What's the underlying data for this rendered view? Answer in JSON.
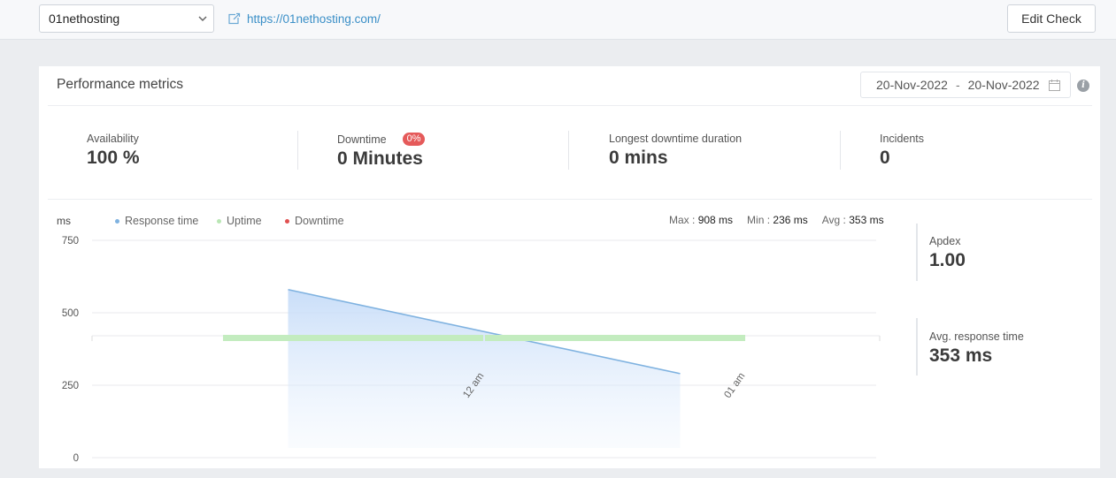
{
  "topbar": {
    "monitor_name": "01nethosting",
    "url": "https://01nethosting.com/",
    "edit_label": "Edit Check"
  },
  "card": {
    "title": "Performance metrics",
    "date_from": "20-Nov-2022",
    "date_sep": "-",
    "date_to": "20-Nov-2022"
  },
  "stats": {
    "availability": {
      "label": "Availability",
      "value": "100 %"
    },
    "downtime": {
      "label": "Downtime",
      "badge": "0%",
      "value": "0 Minutes"
    },
    "longest": {
      "label": "Longest downtime duration",
      "value": "0 mins"
    },
    "incidents": {
      "label": "Incidents",
      "value": "0"
    }
  },
  "side": {
    "apdex": {
      "label": "Apdex",
      "value": "1.00"
    },
    "avg_response": {
      "label": "Avg. response time",
      "value": "353 ms"
    }
  },
  "chart_data": {
    "type": "area",
    "ylabel": "ms",
    "ylim": [
      0,
      750
    ],
    "yticks": [
      0,
      250,
      500,
      750
    ],
    "xticks": [
      "12 am",
      "01 am"
    ],
    "legend": [
      {
        "name": "Response time",
        "color": "#7fb2e0"
      },
      {
        "name": "Uptime",
        "color": "#b9e6b4"
      },
      {
        "name": "Downtime",
        "color": "#e05050"
      }
    ],
    "summary": {
      "max_label": "Max :",
      "max_value": "908 ms",
      "min_label": "Min :",
      "min_value": "236 ms",
      "avg_label": "Avg :",
      "avg_value": "353 ms"
    },
    "series": [
      {
        "name": "Response time",
        "points": [
          {
            "x": 0.25,
            "y": 580
          },
          {
            "x": 0.75,
            "y": 290
          }
        ]
      }
    ],
    "uptime_band": [
      0.167,
      0.833
    ],
    "colors": {
      "line": "#7fb2e0",
      "area_top": "#c6dcf8",
      "uptime": "#c3ecbf"
    }
  }
}
